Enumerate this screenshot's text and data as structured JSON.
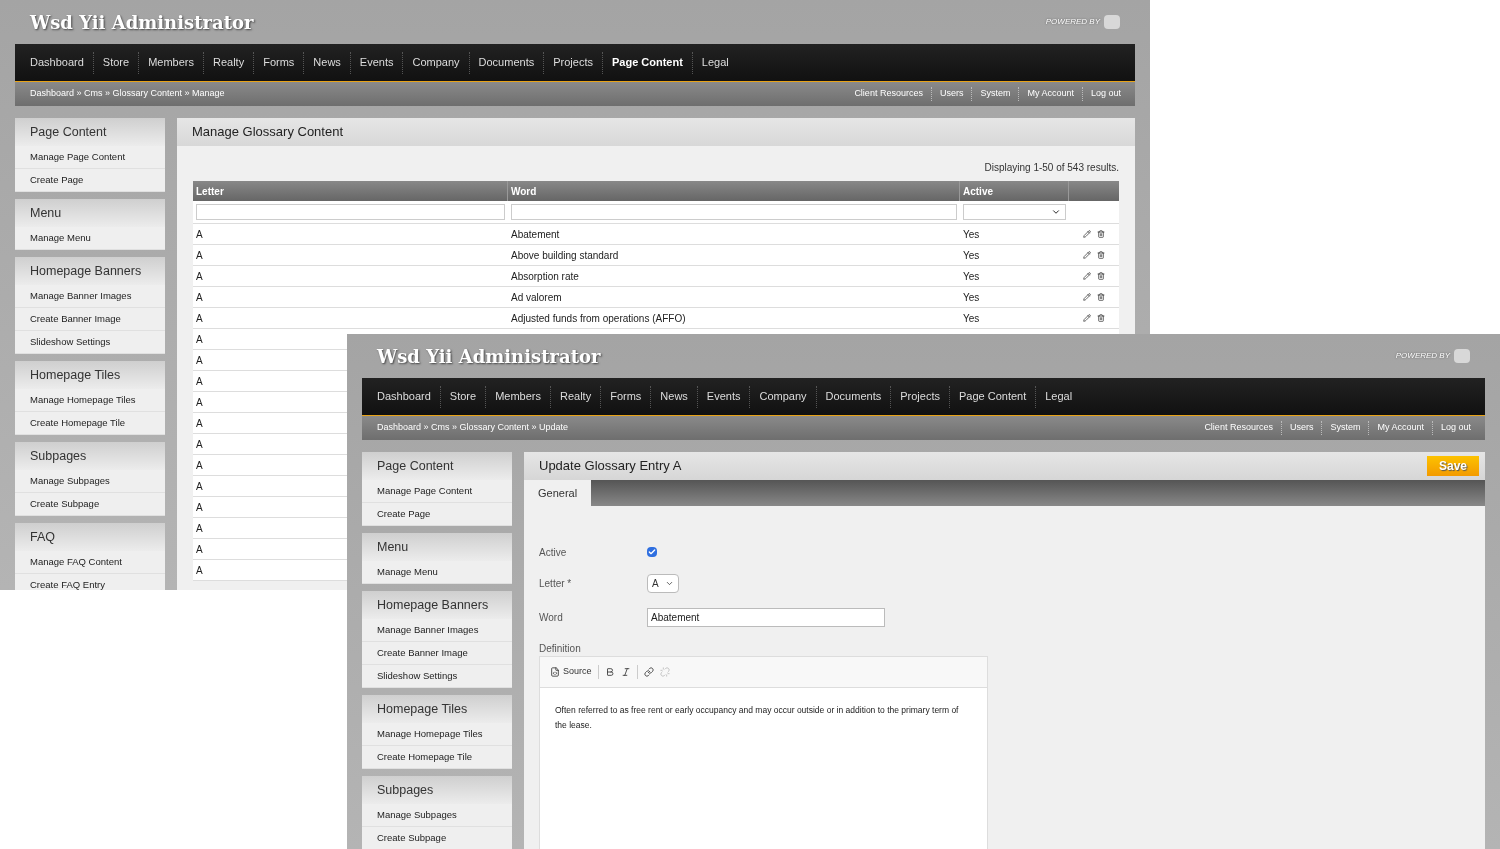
{
  "back_window": {
    "title": "Wsd Yii Administrator",
    "powered_by": "POWERED BY",
    "nav": [
      {
        "label": "Dashboard",
        "selected": false
      },
      {
        "label": "Store",
        "selected": false
      },
      {
        "label": "Members",
        "selected": false
      },
      {
        "label": "Realty",
        "selected": false
      },
      {
        "label": "Forms",
        "selected": false
      },
      {
        "label": "News",
        "selected": false
      },
      {
        "label": "Events",
        "selected": false
      },
      {
        "label": "Company",
        "selected": false
      },
      {
        "label": "Documents",
        "selected": false
      },
      {
        "label": "Projects",
        "selected": false
      },
      {
        "label": "Page Content",
        "selected": true
      },
      {
        "label": "Legal",
        "selected": false
      }
    ],
    "breadcrumb": "Dashboard » Cms » Glossary Content » Manage",
    "account_links": [
      "Client Resources",
      "Users",
      "System",
      "My Account",
      "Log out"
    ],
    "sidebar": [
      {
        "heading": "Page Content",
        "items": [
          "Manage Page Content",
          "Create Page"
        ]
      },
      {
        "heading": "Menu",
        "items": [
          "Manage Menu"
        ]
      },
      {
        "heading": "Homepage Banners",
        "items": [
          "Manage Banner Images",
          "Create Banner Image",
          "Slideshow Settings"
        ]
      },
      {
        "heading": "Homepage Tiles",
        "items": [
          "Manage Homepage Tiles",
          "Create Homepage Tile"
        ]
      },
      {
        "heading": "Subpages",
        "items": [
          "Manage Subpages",
          "Create Subpage"
        ]
      },
      {
        "heading": "FAQ",
        "items": [
          "Manage FAQ Content",
          "Create FAQ Entry"
        ]
      }
    ],
    "panel": {
      "title": "Manage Glossary Content",
      "summary": "Displaying 1-50 of 543 results.",
      "columns": [
        "Letter",
        "Word",
        "Active"
      ],
      "rows": [
        {
          "letter": "A",
          "word": "Abatement",
          "active": "Yes"
        },
        {
          "letter": "A",
          "word": "Above building standard",
          "active": "Yes"
        },
        {
          "letter": "A",
          "word": "Absorption rate",
          "active": "Yes"
        },
        {
          "letter": "A",
          "word": "Ad valorem",
          "active": "Yes"
        },
        {
          "letter": "A",
          "word": "Adjusted funds from operations (AFFO)",
          "active": "Yes"
        },
        {
          "letter": "A"
        },
        {
          "letter": "A"
        },
        {
          "letter": "A"
        },
        {
          "letter": "A"
        },
        {
          "letter": "A"
        },
        {
          "letter": "A"
        },
        {
          "letter": "A"
        },
        {
          "letter": "A"
        },
        {
          "letter": "A"
        },
        {
          "letter": "A"
        },
        {
          "letter": "A"
        },
        {
          "letter": "A"
        }
      ]
    }
  },
  "front_window": {
    "title": "Wsd Yii Administrator",
    "powered_by": "POWERED BY",
    "nav": [
      {
        "label": "Dashboard",
        "selected": false
      },
      {
        "label": "Store",
        "selected": false
      },
      {
        "label": "Members",
        "selected": false
      },
      {
        "label": "Realty",
        "selected": false
      },
      {
        "label": "Forms",
        "selected": false
      },
      {
        "label": "News",
        "selected": false
      },
      {
        "label": "Events",
        "selected": false
      },
      {
        "label": "Company",
        "selected": false
      },
      {
        "label": "Documents",
        "selected": false
      },
      {
        "label": "Projects",
        "selected": false
      },
      {
        "label": "Page Content",
        "selected": false
      },
      {
        "label": "Legal",
        "selected": false
      }
    ],
    "breadcrumb": "Dashboard » Cms » Glossary Content » Update",
    "account_links": [
      "Client Resources",
      "Users",
      "System",
      "My Account",
      "Log out"
    ],
    "sidebar": [
      {
        "heading": "Page Content",
        "items": [
          "Manage Page Content",
          "Create Page"
        ]
      },
      {
        "heading": "Menu",
        "items": [
          "Manage Menu"
        ]
      },
      {
        "heading": "Homepage Banners",
        "items": [
          "Manage Banner Images",
          "Create Banner Image",
          "Slideshow Settings"
        ]
      },
      {
        "heading": "Homepage Tiles",
        "items": [
          "Manage Homepage Tiles",
          "Create Homepage Tile"
        ]
      },
      {
        "heading": "Subpages",
        "items": [
          "Manage Subpages",
          "Create Subpage"
        ]
      }
    ],
    "form": {
      "title": "Update Glossary Entry A",
      "save": "Save",
      "tabs": [
        {
          "label": "General",
          "selected": true
        }
      ],
      "active": {
        "label": "Active",
        "checked": true
      },
      "letter": {
        "label": "Letter *",
        "value": "A"
      },
      "word": {
        "label": "Word",
        "value": "Abatement"
      },
      "definition": {
        "label": "Definition",
        "toolbar": [
          {
            "kind": "source",
            "label": "Source",
            "disabled": false
          },
          {
            "kind": "bold",
            "disabled": false
          },
          {
            "kind": "italic",
            "disabled": false
          },
          {
            "kind": "link",
            "disabled": false
          },
          {
            "kind": "unlink",
            "disabled": true
          }
        ],
        "text": "Often referred to as free rent or early occupancy and may occur outside or in addition to the primary term of the lease."
      }
    }
  }
}
